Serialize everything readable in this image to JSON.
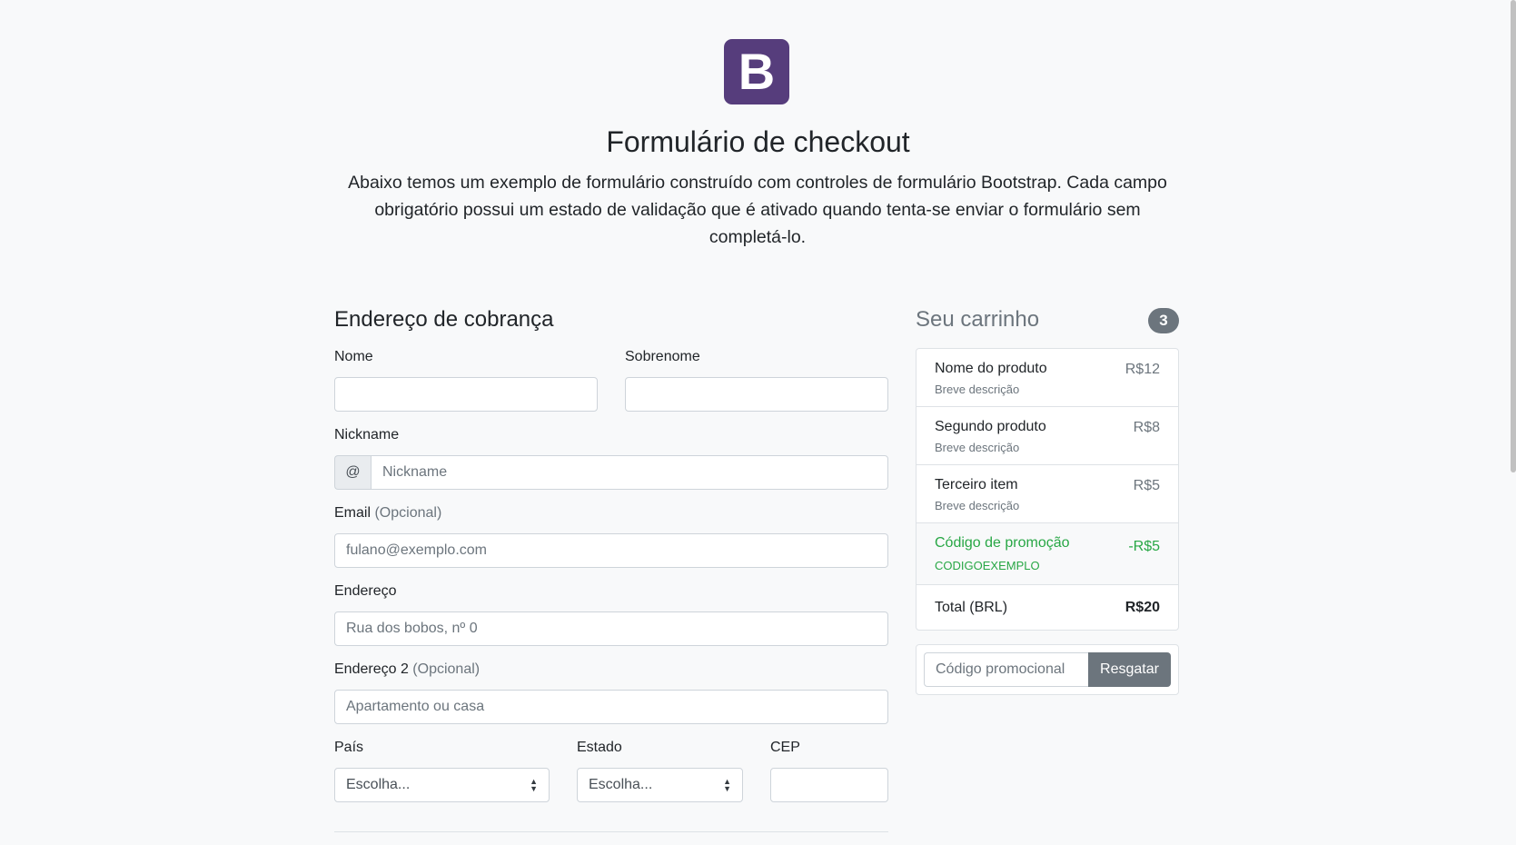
{
  "header": {
    "logo_letter": "B",
    "title": "Formulário de checkout",
    "lead": "Abaixo temos um exemplo de formulário construído com controles de formulário Bootstrap. Cada campo obrigatório possui um estado de validação que é ativado quando tenta-se enviar o formulário sem completá-lo."
  },
  "billing": {
    "heading": "Endereço de cobrança",
    "first_name_label": "Nome",
    "last_name_label": "Sobrenome",
    "nickname_label": "Nickname",
    "nickname_prefix": "@",
    "nickname_placeholder": "Nickname",
    "email_label": "Email",
    "optional": "(Opcional)",
    "email_placeholder": "fulano@exemplo.com",
    "address_label": "Endereço",
    "address_placeholder": "Rua dos bobos, nº 0",
    "address2_label": "Endereço 2",
    "address2_placeholder": "Apartamento ou casa",
    "country_label": "País",
    "country_value": "Escolha...",
    "state_label": "Estado",
    "state_value": "Escolha...",
    "zip_label": "CEP"
  },
  "cart": {
    "heading": "Seu carrinho",
    "count": "3",
    "items": [
      {
        "name": "Nome do produto",
        "desc": "Breve descrição",
        "price": "R$12"
      },
      {
        "name": "Segundo produto",
        "desc": "Breve descrição",
        "price": "R$8"
      },
      {
        "name": "Terceiro item",
        "desc": "Breve descrição",
        "price": "R$5"
      }
    ],
    "promo": {
      "name": "Código de promoção",
      "code": "CODIGOEXEMPLO",
      "price": "-R$5"
    },
    "total_label": "Total (BRL)",
    "total_value": "R$20",
    "promo_placeholder": "Código promocional",
    "redeem_label": "Resgatar"
  },
  "colors": {
    "brand": "#563d7c",
    "success": "#28a745",
    "secondary": "#6c757d"
  }
}
